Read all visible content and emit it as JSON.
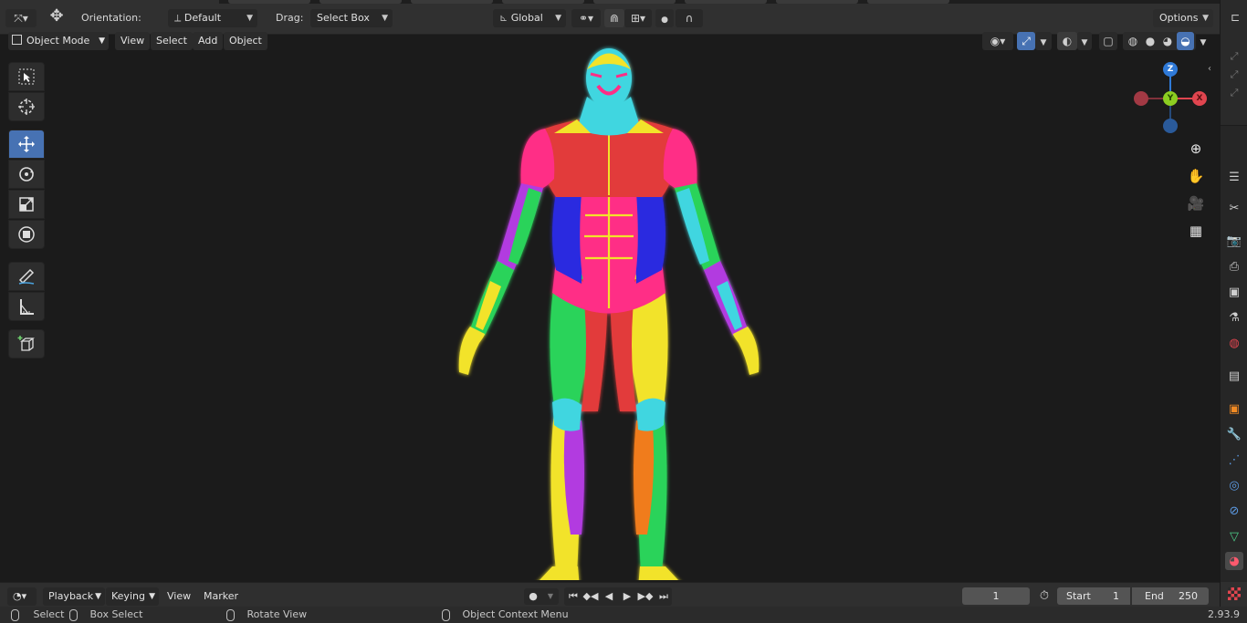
{
  "header": {
    "orientation_label": "Orientation:",
    "orientation_value": "Default",
    "drag_label": "Drag:",
    "drag_value": "Select Box",
    "transform_space": "Global",
    "options_label": "Options"
  },
  "viewport_header": {
    "mode": "Object Mode",
    "menus": [
      "View",
      "Select",
      "Add",
      "Object"
    ]
  },
  "toolbar": {
    "tools": [
      "select-box",
      "cursor",
      "move",
      "rotate",
      "scale",
      "transform",
      "annotate",
      "measure",
      "add-cube"
    ],
    "active_tool": "move"
  },
  "gizmo": {
    "axes": {
      "x": "X",
      "y": "Y",
      "z": "Z"
    },
    "colors": {
      "x": "#e0454f",
      "y": "#8ccd21",
      "z": "#2f7ad8",
      "neg_x": "#a23944",
      "neg_z": "#2a5a9a"
    }
  },
  "timeline": {
    "editor_menus": [
      "Playback",
      "Keying",
      "View",
      "Marker"
    ],
    "current_frame": "1",
    "start_label": "Start",
    "start_value": "1",
    "end_label": "End",
    "end_value": "250"
  },
  "statusbar": {
    "select": "Select",
    "box_select": "Box Select",
    "rotate_view": "Rotate View",
    "context_menu": "Object Context Menu",
    "version": "2.93.9"
  },
  "scene": {
    "object": "muscular human anatomy model in A-pose",
    "muscle_colors": [
      "#ff2e86",
      "#e23a3a",
      "#2a2ae0",
      "#2ad35a",
      "#f2e32a",
      "#f07b1a",
      "#40d6e0",
      "#b23ae0"
    ]
  }
}
